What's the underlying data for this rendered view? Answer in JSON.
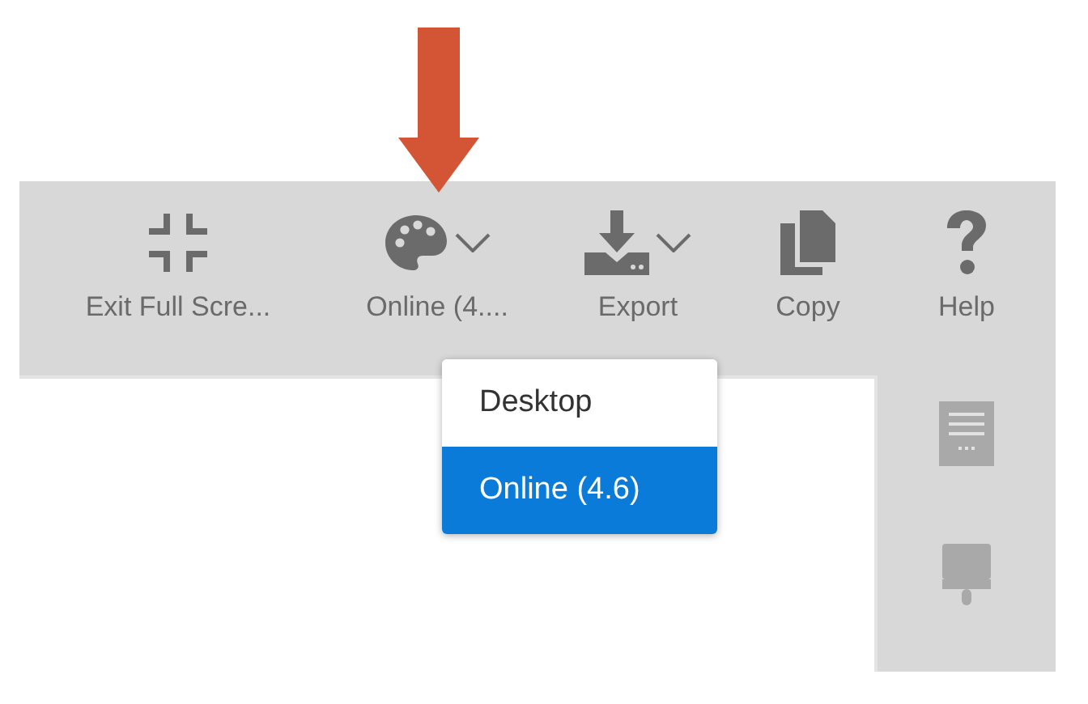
{
  "toolbar": {
    "items": [
      {
        "label": "Exit Full Scre...",
        "kind": "button"
      },
      {
        "label": "Online (4....",
        "kind": "dropdown"
      },
      {
        "label": "Export",
        "kind": "dropdown"
      },
      {
        "label": "Copy",
        "kind": "button"
      },
      {
        "label": "Help",
        "kind": "button"
      }
    ]
  },
  "menu": {
    "items": [
      {
        "label": "Desktop",
        "selected": false
      },
      {
        "label": "Online (4.6)",
        "selected": true
      }
    ]
  }
}
